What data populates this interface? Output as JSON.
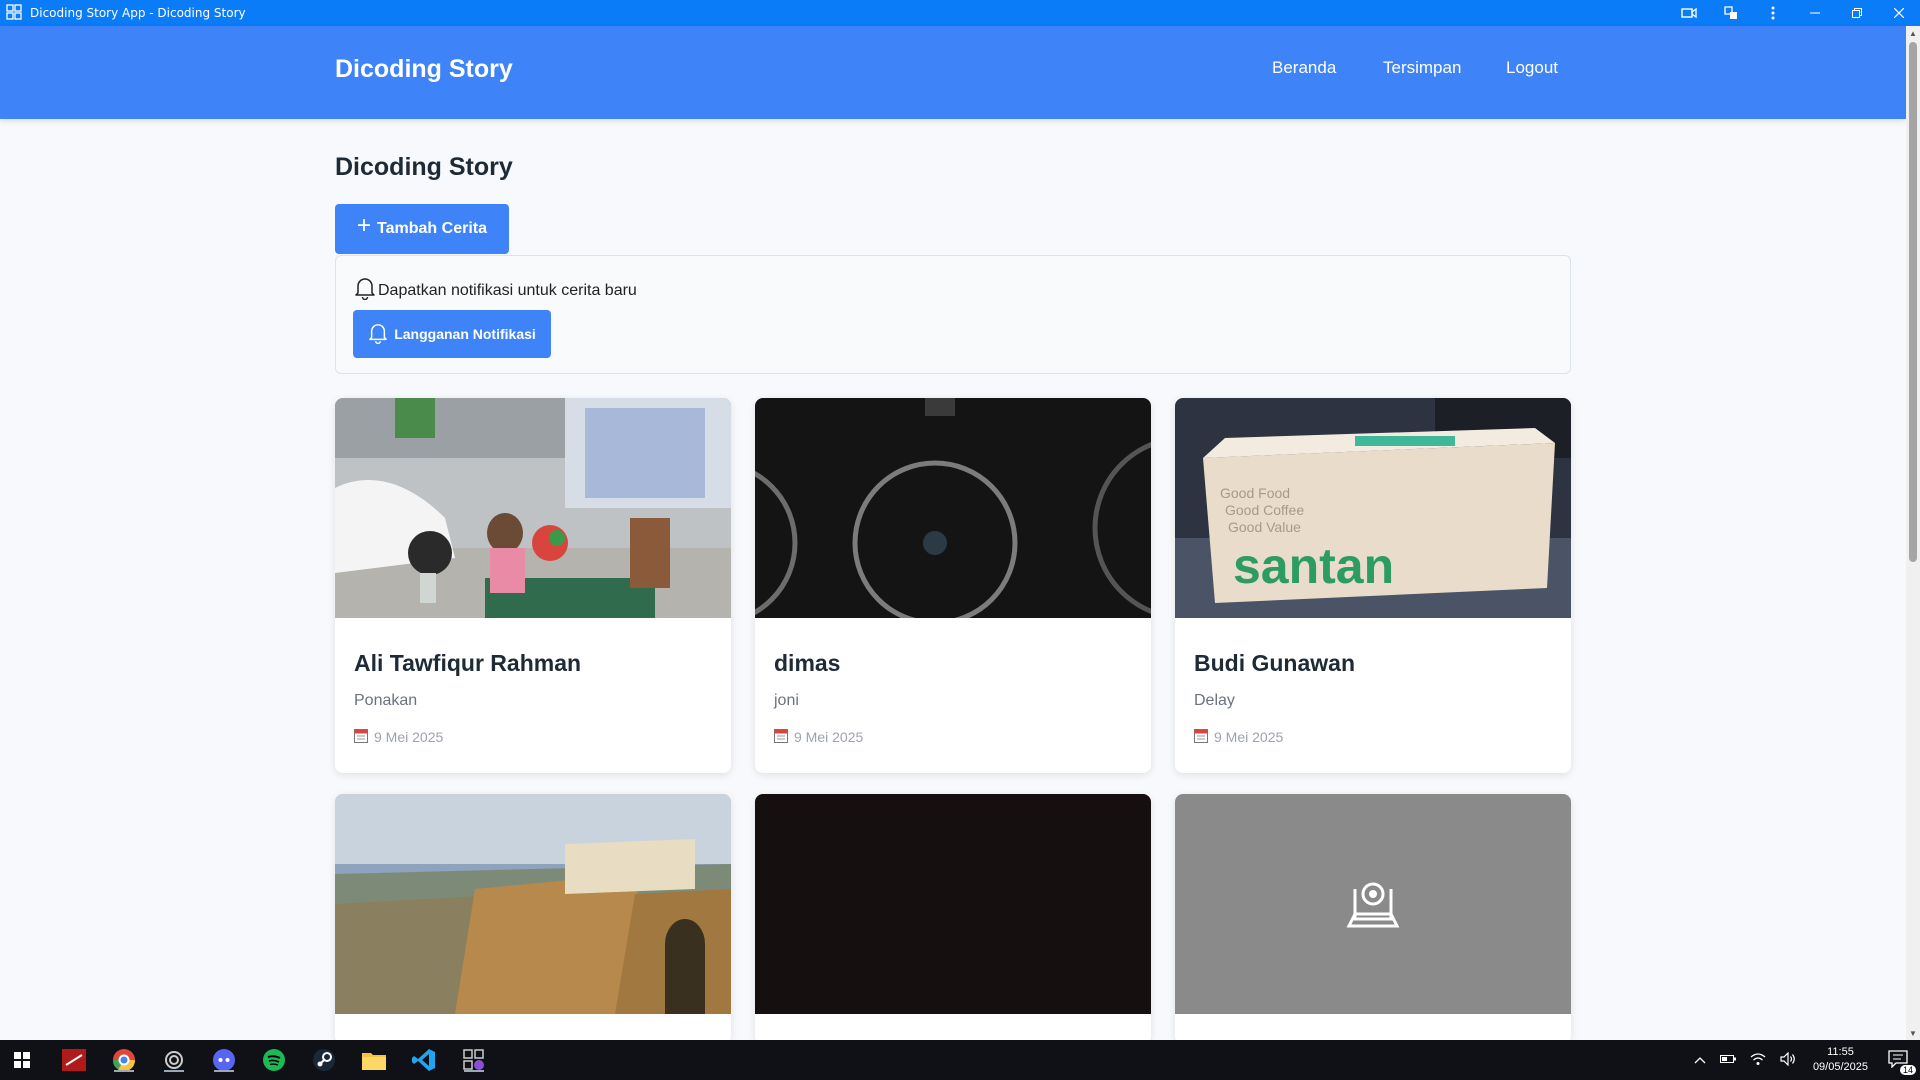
{
  "window": {
    "title": "Dicoding Story App - Dicoding Story"
  },
  "navbar": {
    "brand": "Dicoding Story",
    "links": [
      {
        "label": "Beranda"
      },
      {
        "label": "Tersimpan"
      },
      {
        "label": "Logout"
      }
    ]
  },
  "main": {
    "title": "Dicoding Story",
    "add_button": "Tambah Cerita",
    "notification": {
      "text": "Dapatkan notifikasi untuk cerita baru",
      "button": "Langganan Notifikasi"
    },
    "stories": [
      {
        "name": "Ali Tawfiqur Rahman",
        "description": "Ponakan",
        "date": "9 Mei 2025",
        "photo": "child-playing"
      },
      {
        "name": "dimas",
        "description": "joni",
        "date": "9 Mei 2025",
        "photo": "dark-rings"
      },
      {
        "name": "Budi Gunawan",
        "description": "Delay",
        "date": "9 Mei 2025",
        "photo": "santan-box"
      },
      {
        "photo": "cliff-town"
      },
      {
        "photo": "dark"
      },
      {
        "photo": "placeholder"
      }
    ]
  },
  "taskbar": {
    "time": "11:55",
    "date": "09/05/2025",
    "notification_count": "14"
  },
  "colors": {
    "titlebar": "#0a7cf8",
    "primary": "#3f83f8",
    "background": "#f7f9fc"
  }
}
